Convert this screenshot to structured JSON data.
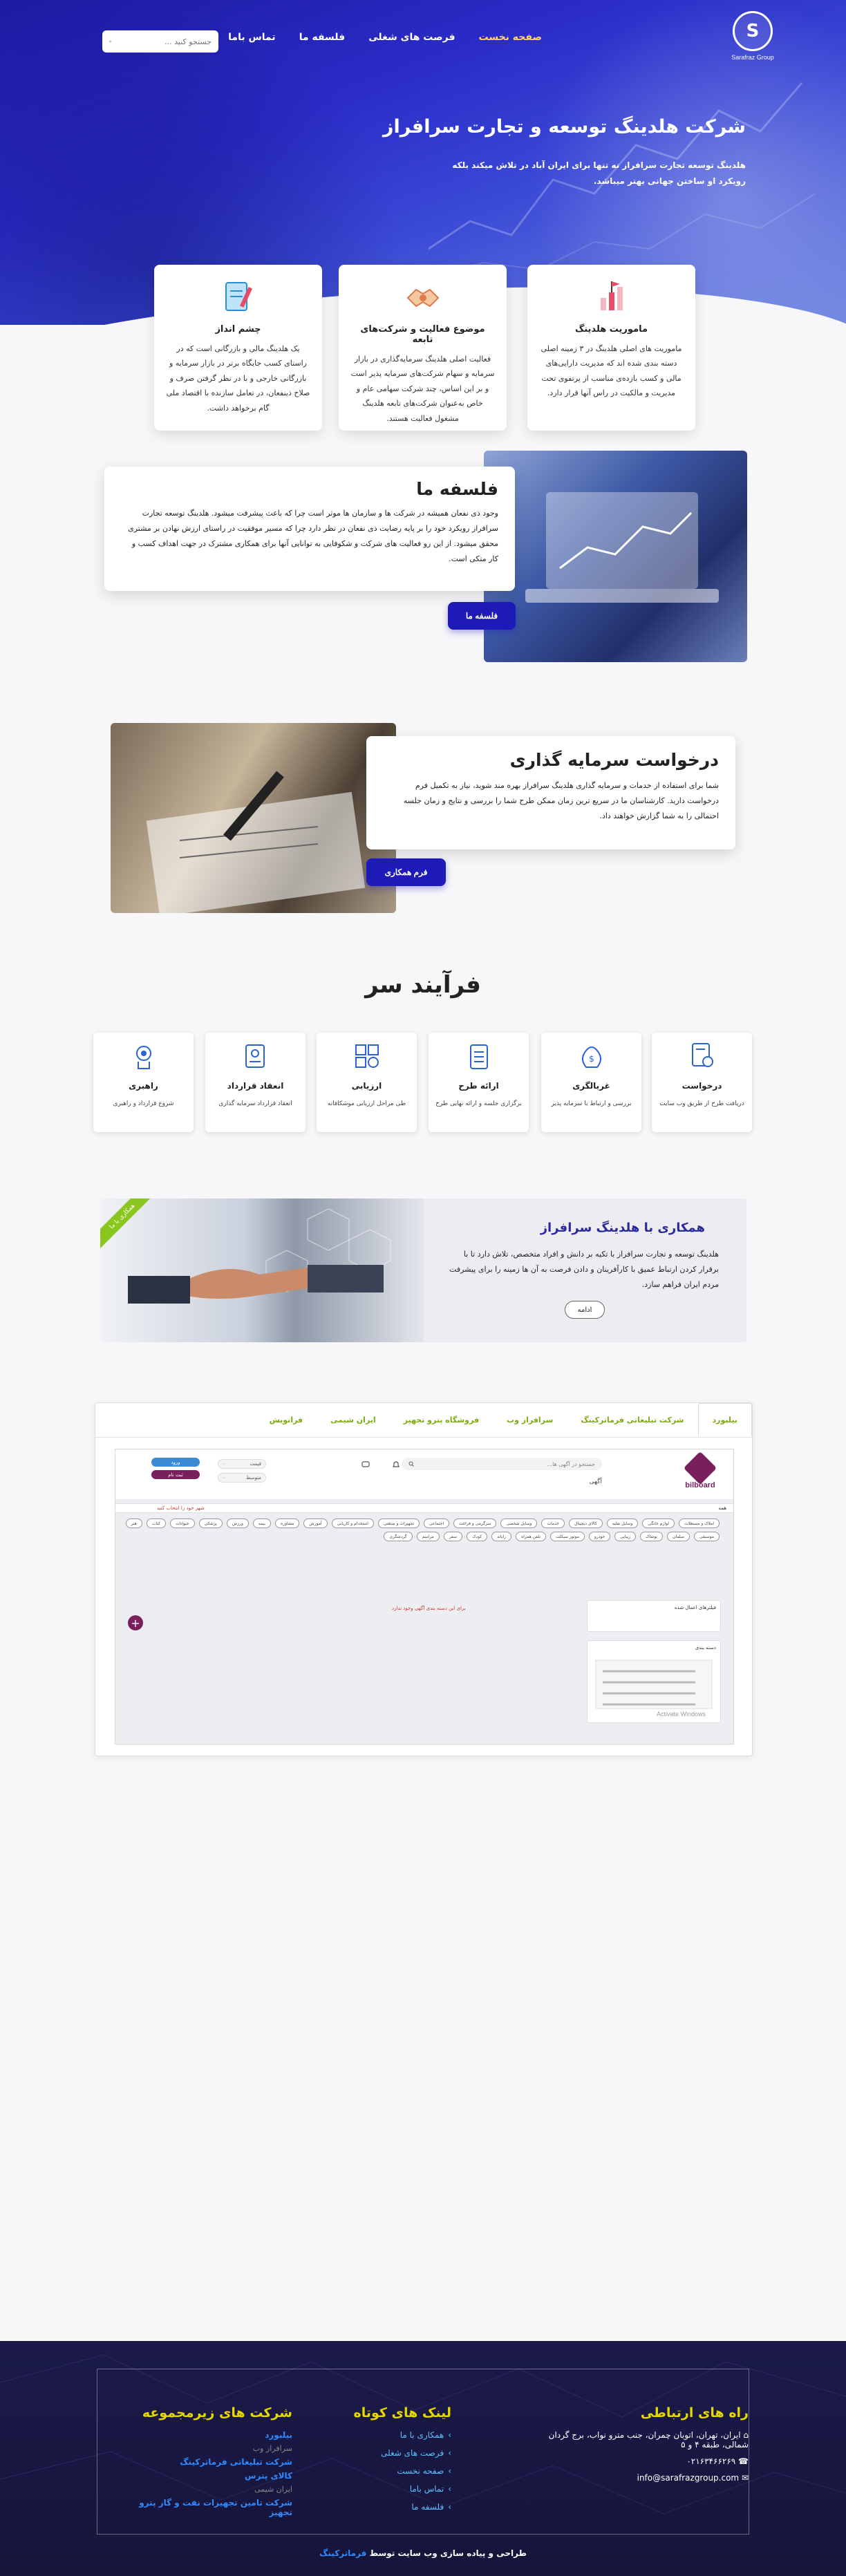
{
  "header": {
    "logo_text": "Sarafraz Group",
    "logo_letter": "S",
    "nav": [
      "صفحه نخست",
      "فرصت های شغلی",
      "فلسفه ما",
      "تماس باما"
    ],
    "search_placeholder": "جستجو کنید ..."
  },
  "hero": {
    "title": "شرکت هلدینگ توسعه و تجارت سرافراز",
    "subtitle": "هلدینگ توسعه تجارت سرافراز نه تنها برای ایران آباد در تلاش میکند بلکه رویکرد او ساختن جهانی بهتر میباشد."
  },
  "features": [
    {
      "title": "ماموریت هلدینگ",
      "text": "ماموریت های اصلی هلدینگ در ۳ زمینه اصلی دسته بندی شده اند که مدیریت دارایی‌های مالی و کسب بازده‌ی مناسب از پرتفوی تحت مدیریت و مالکیت در راس آنها قرار دارد."
    },
    {
      "title": "موضوع فعالیت و شرکت‌های تابعه",
      "text": "فعالیت اصلی هلدینگ سرمایه‌گذاری در بازار سرمایه و سهام شرکت‌های سرمایه پذیر است و بر این اساس، چند شرکت سهامی عام و خاص به‌عنوان شرکت‌های تابعه هلدینگ مشغول فعالیت هستند."
    },
    {
      "title": "چشم انداز",
      "text": "یک هلدینگ مالی و بازرگانی است که در راستای کسب جایگاه برتر در بازار سرمایه و بازرگانی خارجی و با در نظر گرفتن صرف و صلاح ذینفعان، در تعامل سازنده با اقتصاد ملی گام برخواهد داشت."
    }
  ],
  "philosophy": {
    "title": "فلسفه ما",
    "text": "وجود ذی نفعان همیشه در شرکت ها و سازمان ها موثر است چرا که باعث پیشرفت میشود. هلدینگ توسعه تجارت سرافراز رویکرد خود را بر پایه رضایت ذی نفعان در نظر دارد چرا که مسیر موفقیت در راستای ارزش نهادن بر مشتری محقق میشود. از این رو فعالیت های شرکت و شکوفایی به توانایی آنها برای همکاری مشترک در جهت اهداف کسب و کار متکی است.",
    "button": "فلسفه ما"
  },
  "invest": {
    "title": "درخواست سرمایه گذاری",
    "text": "شما برای استفاده از خدمات و سرمایه گذاری هلدینگ سرافراز بهره مند شوید، نیاز به تکمیل فرم درخواست دارید. کارشناسان ما در سریع ترین زمان ممکن طرح شما را بررسی و نتایج و زمان جلسه احتمالی را به شما گزارش خواهند داد.",
    "button": "فرم همکاری"
  },
  "process": {
    "title": "فرآیند سر",
    "steps": [
      {
        "title": "درخواست",
        "text": "دریافت طرح از طریق وب سایت"
      },
      {
        "title": "غربالگری",
        "text": "بررسی و ارتباط با سرمایه پذیر"
      },
      {
        "title": "ارائه طرح",
        "text": "برگزاری جلسه و ارائه نهایی طرح"
      },
      {
        "title": "ارزیابی",
        "text": "طی مراحل ارزیابی موشکافانه"
      },
      {
        "title": "انعقاد قرارداد",
        "text": "انعقاد قرارداد سرمایه گذاری"
      },
      {
        "title": "راهبری",
        "text": "شروع قرارداد و راهبری"
      }
    ]
  },
  "coop": {
    "ribbon": "همکاری با ما",
    "title": "همکاری با هلدینگ سرافراز",
    "text": "هلدینگ توسعه و تجارت سرافراز با تکیه بر دانش و افراد متخصص، تلاش دارد تا با برقرار کردن ارتباط عمیق با کارآفرینان و دادن فرصت به آن ها زمینه را برای پیشرفت مردم ایران فراهم سازد.",
    "more": "ادامه"
  },
  "tabs": {
    "items": [
      "بیلبورد",
      "شرکت تبلیغاتی فرماترکینگ",
      "سرافراز وب",
      "فروشگاه پترو تجهیز",
      "ایران شیمی",
      "فراتویش"
    ],
    "shot": {
      "logo": "bilboard",
      "search": "جستجو در آگهی ها...",
      "ads": "آگهی",
      "btn1": "ورود",
      "btn2": "ثبت نام",
      "label1": "قیمت",
      "label2": "متوسط",
      "bar_left": "همه",
      "bar_right": "شهر خود را انتخاب کنید",
      "chips": [
        "املاک و مستغلات",
        "لوازم خانگی",
        "وسایل نقلیه",
        "کالای دیجیتال",
        "خدمات",
        "وسایل شخصی",
        "سرگرمی و فراغت",
        "اجتماعی",
        "تجهیزات و صنعتی",
        "استخدام و کاریابی",
        "آموزش",
        "مشاوره",
        "بیمه",
        "ورزش",
        "پزشکی",
        "حیوانات",
        "کتاب",
        "هنر",
        "موسیقی",
        "مبلمان",
        "پوشاک",
        "زیبایی",
        "خودرو",
        "موتور سیکلت",
        "تلفن همراه",
        "رایانه",
        "کودک",
        "سفر",
        "مراسم",
        "گردشگری"
      ],
      "no_ads": "برای این دسته بندی آگهی وجود ندارد",
      "side1": "فیلترهای اعمال شده",
      "side2": "دسته بندی",
      "activate": "Activate Windows"
    }
  },
  "footer": {
    "contact_title": "راه های ارتباطی",
    "address": "ایران، تهران، اتوبان چمران، جنب مترو نواب، برج گردان شمالی، طبقه ۴ و ۵",
    "phone": "۰۲۱۶۳۴۶۶۲۶۹",
    "email": "info@sarafrazgroup.com",
    "links_title": "لینک های کوتاه",
    "links": [
      "همکاری با ما",
      "فرصت های شغلی",
      "صفحه نخست",
      "تماس باما",
      "فلسفه ما"
    ],
    "subs_title": "شرکت های زیرمجموعه",
    "subs": [
      {
        "name": "بیلبورد",
        "muted": false
      },
      {
        "name": "سرافراز وب",
        "muted": true
      },
      {
        "name": "شرکت تبلیغاتی فرماترکینگ",
        "muted": false
      },
      {
        "name": "کالای پترس",
        "muted": false
      },
      {
        "name": "ایران شیمی",
        "muted": true
      },
      {
        "name": "شرکت تامین تجهیزات نفت و گاز پترو تجهیز",
        "muted": false
      }
    ],
    "credit_text": "طراحی و پیاده سازی وب سایت توسط",
    "credit_brand": "فرماترکینگ"
  }
}
